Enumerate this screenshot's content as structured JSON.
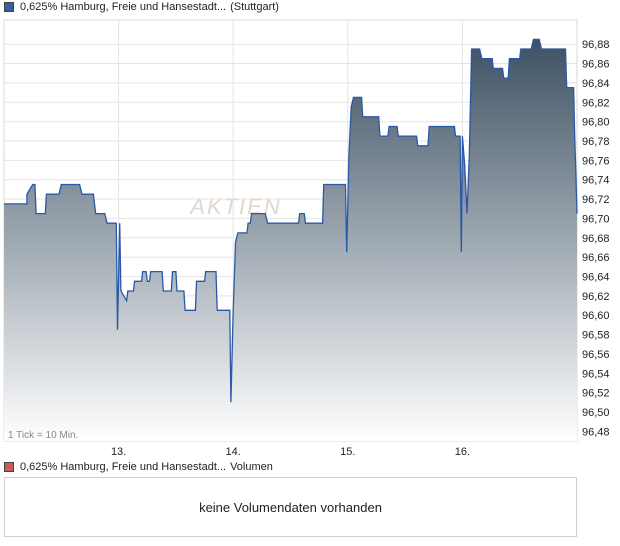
{
  "price_legend": {
    "name": "0,625% Hamburg, Freie und Hansestadt...",
    "exchange": "(Stuttgart)",
    "color": "#3a5f9f"
  },
  "volume_legend": {
    "name": "0,625% Hamburg, Freie und Hansestadt...",
    "label": "Volumen",
    "color": "#c85a5a"
  },
  "volume_panel": {
    "message": "keine Volumendaten vorhanden"
  },
  "watermark": "AKTIEN",
  "colors": {
    "line": "#2a58a8",
    "fill_top": "#3d5163",
    "fill_bottom": "#ffffff",
    "grid": "#e4e4e4"
  },
  "chart_data": {
    "type": "area",
    "title": "",
    "xlabel": "",
    "ylabel": "",
    "tick_note": "1 Tick = 10 Min.",
    "x_ticks": [
      {
        "label": "13.",
        "x": 1
      },
      {
        "label": "14.",
        "x": 2
      },
      {
        "label": "15.",
        "x": 3
      },
      {
        "label": "16.",
        "x": 4
      }
    ],
    "xlim": [
      0,
      5
    ],
    "ylim": [
      96.47,
      96.905
    ],
    "y_ticks": [
      "96,48",
      "96,50",
      "96,52",
      "96,54",
      "96,56",
      "96,58",
      "96,60",
      "96,62",
      "96,64",
      "96,66",
      "96,68",
      "96,70",
      "96,72",
      "96,74",
      "96,76",
      "96,78",
      "96,80",
      "96,82",
      "96,84",
      "96,86",
      "96,88"
    ],
    "grid": true,
    "series": [
      {
        "points": [
          [
            0.0,
            96.715
          ],
          [
            0.2,
            96.715
          ],
          [
            0.2,
            96.725
          ],
          [
            0.25,
            96.735
          ],
          [
            0.27,
            96.735
          ],
          [
            0.28,
            96.705
          ],
          [
            0.36,
            96.705
          ],
          [
            0.37,
            96.725
          ],
          [
            0.48,
            96.725
          ],
          [
            0.5,
            96.735
          ],
          [
            0.66,
            96.735
          ],
          [
            0.68,
            96.725
          ],
          [
            0.78,
            96.725
          ],
          [
            0.79,
            96.715
          ],
          [
            0.8,
            96.705
          ],
          [
            0.88,
            96.705
          ],
          [
            0.9,
            96.695
          ],
          [
            0.98,
            96.695
          ],
          [
            0.99,
            96.585
          ],
          [
            1.01,
            96.695
          ],
          [
            1.02,
            96.625
          ],
          [
            1.07,
            96.615
          ],
          [
            1.08,
            96.625
          ],
          [
            1.13,
            96.625
          ],
          [
            1.14,
            96.635
          ],
          [
            1.2,
            96.635
          ],
          [
            1.21,
            96.645
          ],
          [
            1.24,
            96.645
          ],
          [
            1.25,
            96.635
          ],
          [
            1.27,
            96.635
          ],
          [
            1.28,
            96.645
          ],
          [
            1.38,
            96.645
          ],
          [
            1.39,
            96.625
          ],
          [
            1.46,
            96.625
          ],
          [
            1.47,
            96.645
          ],
          [
            1.5,
            96.645
          ],
          [
            1.51,
            96.625
          ],
          [
            1.57,
            96.625
          ],
          [
            1.58,
            96.605
          ],
          [
            1.67,
            96.605
          ],
          [
            1.68,
            96.635
          ],
          [
            1.75,
            96.635
          ],
          [
            1.76,
            96.645
          ],
          [
            1.85,
            96.645
          ],
          [
            1.86,
            96.605
          ],
          [
            1.97,
            96.605
          ],
          [
            1.98,
            96.51
          ],
          [
            2.0,
            96.605
          ],
          [
            2.02,
            96.675
          ],
          [
            2.04,
            96.685
          ],
          [
            2.12,
            96.685
          ],
          [
            2.13,
            96.695
          ],
          [
            2.15,
            96.695
          ],
          [
            2.16,
            96.705
          ],
          [
            2.28,
            96.705
          ],
          [
            2.3,
            96.695
          ],
          [
            2.57,
            96.695
          ],
          [
            2.58,
            96.705
          ],
          [
            2.62,
            96.705
          ],
          [
            2.63,
            96.695
          ],
          [
            2.78,
            96.695
          ],
          [
            2.79,
            96.735
          ],
          [
            2.98,
            96.735
          ],
          [
            2.99,
            96.665
          ],
          [
            3.01,
            96.765
          ],
          [
            3.03,
            96.815
          ],
          [
            3.05,
            96.825
          ],
          [
            3.12,
            96.825
          ],
          [
            3.13,
            96.805
          ],
          [
            3.27,
            96.805
          ],
          [
            3.28,
            96.785
          ],
          [
            3.35,
            96.785
          ],
          [
            3.36,
            96.795
          ],
          [
            3.43,
            96.795
          ],
          [
            3.44,
            96.785
          ],
          [
            3.6,
            96.785
          ],
          [
            3.61,
            96.775
          ],
          [
            3.7,
            96.775
          ],
          [
            3.71,
            96.795
          ],
          [
            3.93,
            96.795
          ],
          [
            3.94,
            96.785
          ],
          [
            3.98,
            96.785
          ],
          [
            3.99,
            96.665
          ],
          [
            4.0,
            96.785
          ],
          [
            4.02,
            96.755
          ],
          [
            4.04,
            96.705
          ],
          [
            4.06,
            96.765
          ],
          [
            4.08,
            96.875
          ],
          [
            4.15,
            96.875
          ],
          [
            4.17,
            96.865
          ],
          [
            4.26,
            96.865
          ],
          [
            4.27,
            96.855
          ],
          [
            4.35,
            96.855
          ],
          [
            4.36,
            96.845
          ],
          [
            4.4,
            96.845
          ],
          [
            4.41,
            96.865
          ],
          [
            4.5,
            96.865
          ],
          [
            4.51,
            96.875
          ],
          [
            4.6,
            96.875
          ],
          [
            4.62,
            96.885
          ],
          [
            4.67,
            96.885
          ],
          [
            4.69,
            96.875
          ],
          [
            4.9,
            96.875
          ],
          [
            4.91,
            96.835
          ],
          [
            4.97,
            96.835
          ],
          [
            4.98,
            96.785
          ],
          [
            4.99,
            96.745
          ],
          [
            5.0,
            96.705
          ]
        ]
      }
    ]
  }
}
